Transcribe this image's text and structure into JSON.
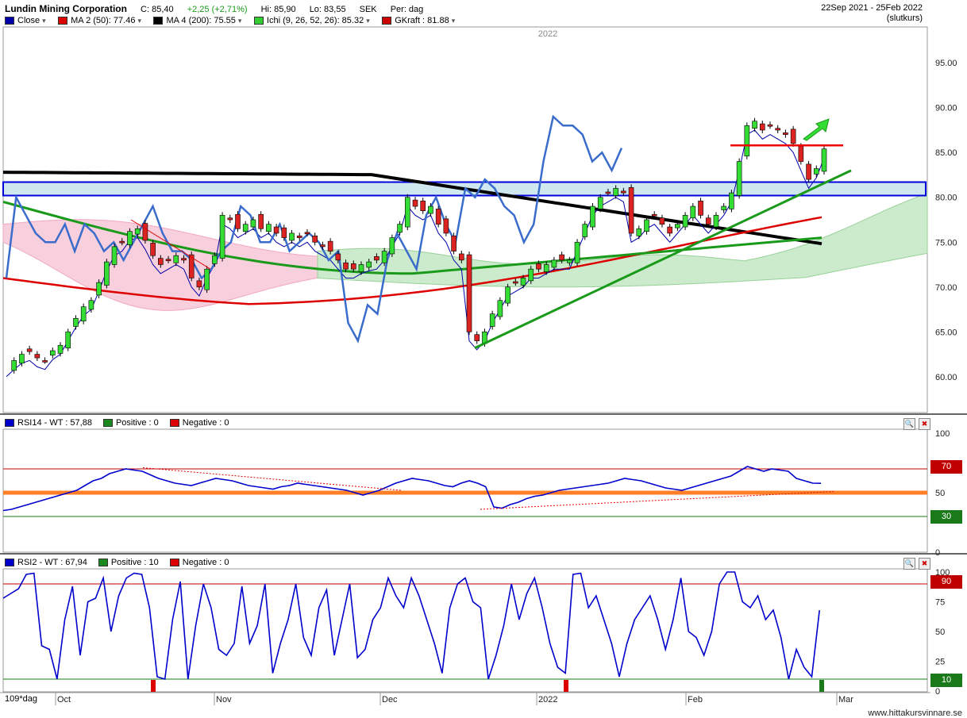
{
  "header": {
    "company": "Lundin Mining Corporation",
    "close": "C: 85,40",
    "change": "+2,25 (+2,71%)",
    "high": "Hi: 85,90",
    "low": "Lo: 83,55",
    "currency": "SEK",
    "period": "Per: dag",
    "date_range": "22Sep 2021 - 25Feb 2022",
    "price_type": "(slutkurs)"
  },
  "legend": [
    {
      "label": "Close",
      "color": "#0000aa"
    },
    {
      "label": "MA 2 (50): 77.46",
      "color": "#dd0000"
    },
    {
      "label": "MA 4 (200): 75.55",
      "color": "#000000"
    },
    {
      "label": "Ichi (9, 26, 52, 26): 85.32",
      "color": "#33cc33"
    },
    {
      "label": "GKraft : 81.88",
      "color": "#cc0000"
    }
  ],
  "year_marker": "2022",
  "price_axis": [
    "95.00",
    "90.00",
    "85.00",
    "80.00",
    "75.00",
    "70.00",
    "65.00",
    "60.00"
  ],
  "rsi14_panel": {
    "label": "RSI14 - WT : 57,88",
    "positive": "Positive : 0",
    "negative": "Negative : 0",
    "axis": [
      "100",
      "70",
      "50",
      "30",
      "0"
    ],
    "upper_badge": "70",
    "lower_badge": "30"
  },
  "rsi2_panel": {
    "label": "RSI2 - WT : 67,94",
    "positive": "Positive : 10",
    "negative": "Negative : 0",
    "axis": [
      "100",
      "75",
      "50",
      "25",
      "0"
    ],
    "upper_badge": "90",
    "lower_badge": "10"
  },
  "x_axis": {
    "period_label": "109*dag",
    "months": [
      "Oct",
      "Nov",
      "Dec",
      "2022",
      "Feb",
      "Mar"
    ]
  },
  "footer": "www.hittakursvinnare.se",
  "colors": {
    "up_candle": "#33dd33",
    "down_candle": "#dd2222",
    "ma200": "#000000",
    "ma50": "#dd0000",
    "cloud_green": "#ccebcc",
    "cloud_pink": "#f8cfdc",
    "rsi_line": "#0000cc",
    "orange_line": "#ff7f27",
    "badge_red": "#c00000",
    "badge_green": "#1a7a1a"
  },
  "chart_data": [
    {
      "type": "candlestick",
      "ylim": [
        56,
        99
      ],
      "xlim": [
        "2021-09-22",
        "2022-03-05"
      ],
      "close_series": [
        61,
        61.8,
        62.5,
        62.8,
        62.1,
        61.8,
        62.9,
        63.5,
        65,
        66.5,
        67.8,
        68.5,
        70.5,
        72.8,
        74.5,
        75,
        76.2,
        76.5,
        75.2,
        73.5,
        72.5,
        73,
        73.5,
        73,
        71,
        70,
        72,
        73.5,
        78,
        77.5,
        76.5,
        77,
        77.5,
        76.5,
        77,
        76,
        75.5,
        76,
        75.5,
        76,
        75,
        74.5,
        74,
        73,
        72,
        72,
        72.5,
        72.8,
        73,
        74,
        75.5,
        77,
        80,
        79,
        78.5,
        79,
        77,
        76,
        74,
        73,
        65,
        64,
        65,
        67,
        68.5,
        70,
        70.5,
        71,
        72,
        72,
        72.5,
        73,
        73,
        73,
        75,
        77,
        79,
        80,
        80.5,
        81,
        80.5,
        76,
        76.5,
        77.5,
        78,
        77,
        76,
        77,
        78,
        79,
        78,
        77,
        78,
        79,
        80.5,
        84,
        88,
        88.5,
        87.5,
        88,
        87.5,
        87,
        86,
        84,
        82,
        83.2,
        85.4
      ],
      "ma50_last": 77.46,
      "ma200_last": 75.55,
      "ichimoku_last": 85.32,
      "gkraft_last": 81.88,
      "resistance_zone": [
        80.2,
        81.7
      ]
    },
    {
      "type": "line",
      "name": "RSI14 - WT",
      "ylim": [
        0,
        100
      ],
      "levels": [
        70,
        50,
        30
      ],
      "values": [
        35,
        36,
        38,
        40,
        42,
        44,
        46,
        48,
        50,
        52,
        56,
        60,
        62,
        66,
        68,
        70,
        69,
        68,
        65,
        62,
        60,
        58,
        57,
        56,
        58,
        60,
        62,
        61,
        60,
        58,
        56,
        55,
        54,
        53,
        55,
        56,
        58,
        57,
        56,
        55,
        54,
        53,
        52,
        50,
        48,
        50,
        52,
        55,
        58,
        60,
        62,
        61,
        60,
        58,
        56,
        55,
        58,
        60,
        58,
        55,
        38,
        37,
        40,
        42,
        45,
        47,
        48,
        50,
        52,
        53,
        54,
        55,
        56,
        57,
        58,
        60,
        62,
        61,
        60,
        58,
        56,
        54,
        53,
        52,
        54,
        56,
        58,
        60,
        62,
        64,
        68,
        72,
        70,
        68,
        70,
        69,
        68,
        62,
        60,
        58,
        57.88
      ],
      "last_value": 57.88
    },
    {
      "type": "line",
      "name": "RSI2 - WT",
      "ylim": [
        0,
        100
      ],
      "levels": [
        90,
        10
      ],
      "values": [
        78,
        82,
        86,
        98,
        99,
        38,
        35,
        10,
        60,
        88,
        30,
        75,
        78,
        95,
        50,
        80,
        95,
        99,
        98,
        70,
        12,
        10,
        60,
        92,
        10,
        55,
        90,
        70,
        35,
        30,
        40,
        88,
        40,
        55,
        90,
        15,
        40,
        60,
        90,
        45,
        30,
        70,
        85,
        30,
        60,
        90,
        28,
        35,
        60,
        70,
        95,
        80,
        70,
        95,
        80,
        60,
        40,
        15,
        70,
        90,
        95,
        75,
        70,
        10,
        30,
        55,
        90,
        60,
        82,
        95,
        70,
        40,
        20,
        15,
        98,
        99,
        70,
        80,
        60,
        40,
        12,
        40,
        60,
        70,
        80,
        60,
        35,
        60,
        95,
        50,
        45,
        30,
        50,
        90,
        100,
        100,
        75,
        70,
        80,
        60,
        68,
        45,
        10,
        35,
        20,
        12,
        67.94
      ],
      "last_value": 67.94
    }
  ]
}
